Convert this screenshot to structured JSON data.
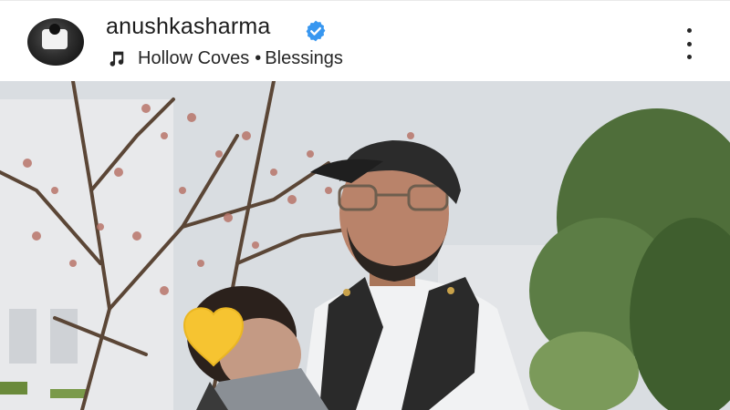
{
  "post": {
    "username": "anushkasharma",
    "verified": true,
    "audio": {
      "artist": "Hollow Coves",
      "separator": "•",
      "track": "Blessings"
    },
    "icons": {
      "verified": "verified-badge-icon",
      "music": "music-note-icon",
      "more": "more-options-icon"
    },
    "colors": {
      "verified_blue": "#3897f0",
      "text": "#262626"
    }
  }
}
